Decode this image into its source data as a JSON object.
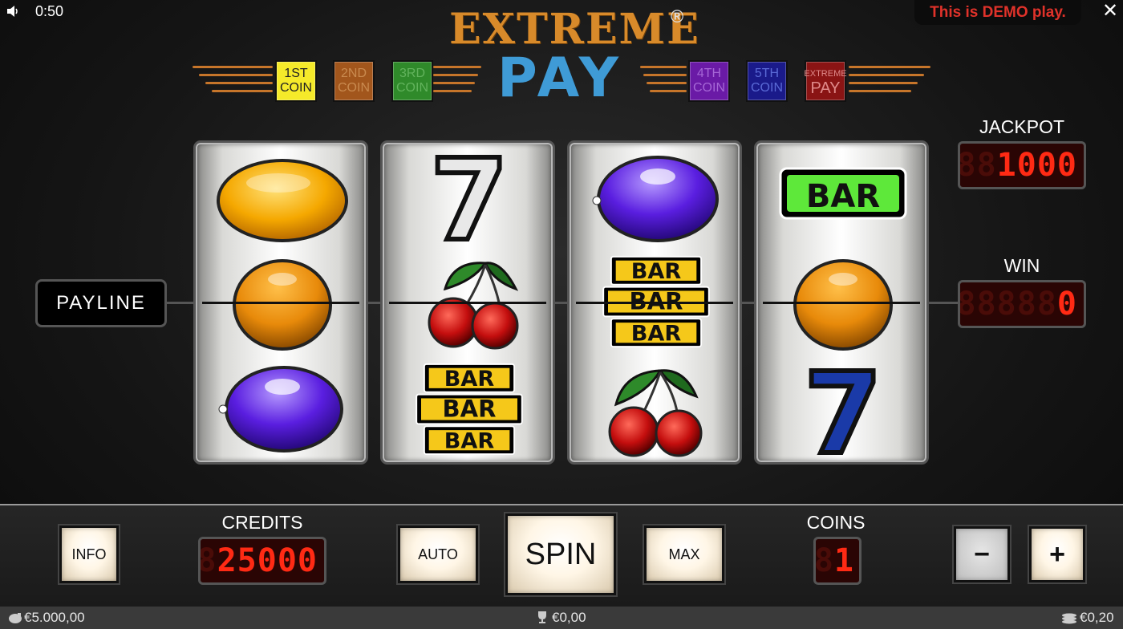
{
  "top_bar": {
    "clock": "0:50",
    "demo_banner": "This is DEMO play.",
    "close_label": "✕"
  },
  "logo": {
    "line1": "EXTREME",
    "registered": "®",
    "line2": "PAY"
  },
  "coin_badges": [
    {
      "line1": "1ST",
      "line2": "COIN",
      "color": "#f5ea2a",
      "text_color": "#222"
    },
    {
      "line1": "2ND",
      "line2": "COIN",
      "color": "#a2561c",
      "text_color": "#c98a4f"
    },
    {
      "line1": "3RD",
      "line2": "COIN",
      "color": "#2f8a2a",
      "text_color": "#62b35c"
    },
    {
      "line1": "4TH",
      "line2": "COIN",
      "color": "#6a1aa6",
      "text_color": "#a566d6"
    },
    {
      "line1": "5TH",
      "line2": "COIN",
      "color": "#1a1a8a",
      "text_color": "#5a6ad6"
    },
    {
      "line1": "EXTREME",
      "line2": "PAY",
      "color": "#8a1414",
      "text_color": "#e08a8a"
    }
  ],
  "reels": [
    [
      "lemon",
      "orange",
      "plum"
    ],
    [
      "seven-white",
      "cherries",
      "triple-bar"
    ],
    [
      "plum",
      "triple-bar",
      "cherries"
    ],
    [
      "single-bar",
      "orange",
      "seven-blue"
    ]
  ],
  "symbol_text": {
    "bar": "BAR",
    "seven": "7"
  },
  "payline_label": "PAYLINE",
  "jackpot": {
    "title": "JACKPOT",
    "value": "1000",
    "ghost": "888"
  },
  "win": {
    "title": "WIN",
    "value": "0",
    "ghost": "88888"
  },
  "controls": {
    "info": "INFO",
    "credits_title": "CREDITS",
    "credits_value": "25000",
    "credits_ghost": "8",
    "auto": "AUTO",
    "spin": "SPIN",
    "max": "MAX",
    "coins_title": "COINS",
    "coins_value": "1",
    "coins_ghost": "8",
    "minus": "−",
    "plus": "+"
  },
  "status_bar": {
    "balance": "€5.000,00",
    "win": "€0,00",
    "bet": "€0,20"
  },
  "colors": {
    "accent_orange": "#d88a2a",
    "accent_blue": "#3f9bd6",
    "led_red": "#ff2a14",
    "demo_red": "#e0322a"
  }
}
